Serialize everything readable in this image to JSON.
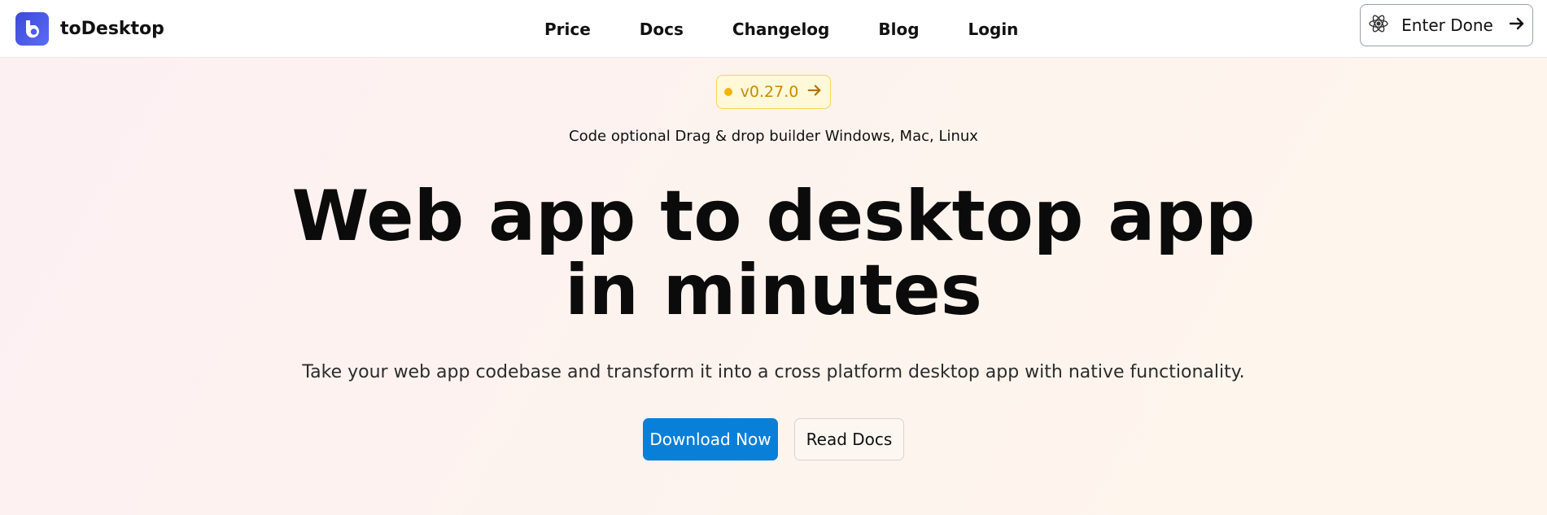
{
  "brand": {
    "name": "toDesktop",
    "logo_icon": "todesktop-logo-icon",
    "accent": "#4455e8"
  },
  "nav": {
    "links": [
      {
        "label": "Price"
      },
      {
        "label": "Docs"
      },
      {
        "label": "Changelog"
      },
      {
        "label": "Blog"
      },
      {
        "label": "Login"
      }
    ],
    "enter_button": {
      "label": "Enter Done",
      "icon": "electron-icon",
      "arrow_icon": "arrow-right-icon"
    }
  },
  "hero": {
    "version_badge": {
      "label": "v0.27.0",
      "dot_color": "#f4b400"
    },
    "tagline": "Code optional Drag & drop builder Windows, Mac, Linux",
    "headline_line1": "Web app to desktop app",
    "headline_line2": "in minutes",
    "subheadline": "Take your web app codebase and transform it into a cross platform desktop app with native functionality.",
    "primary_cta": {
      "label": "Download Now",
      "color": "#0a7fd8"
    },
    "secondary_cta": {
      "label": "Read Docs"
    }
  }
}
